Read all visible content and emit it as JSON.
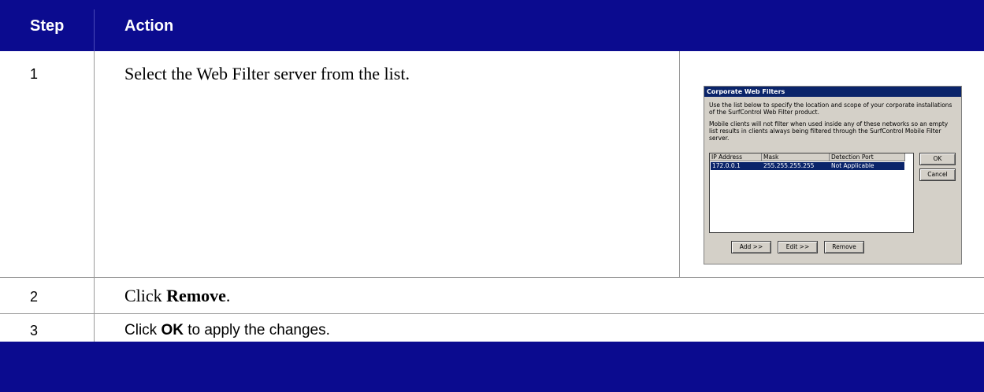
{
  "header": {
    "step_label": "Step",
    "action_label": "Action"
  },
  "rows": [
    {
      "step": "1",
      "text": "Select the Web Filter server from the list."
    },
    {
      "step": "2",
      "text_prefix": "Click ",
      "text_bold": "Remove",
      "text_suffix": "."
    },
    {
      "step": "3",
      "text_prefix": "Click ",
      "text_bold": "OK",
      "text_suffix": " to apply the changes."
    }
  ],
  "dialog": {
    "title": "Corporate Web Filters",
    "para1": "Use the list below to specify the location and scope of your corporate installations of the SurfControl Web Filter product.",
    "para2": "Mobile clients will not filter when used inside any of these networks so an empty list results in clients always being filtered through the SurfControl Mobile Filter server.",
    "columns": [
      "IP Address",
      "Mask",
      "Detection Port"
    ],
    "selected_row": {
      "ip": "172.0.0.1",
      "mask": "255.255.255.255",
      "port": "Not Applicable"
    },
    "buttons": {
      "ok": "OK",
      "cancel": "Cancel",
      "add": "Add >>",
      "edit": "Edit >>",
      "remove": "Remove"
    },
    "colors": {
      "title_bar": "#0a246a",
      "face": "#d4d0c8",
      "selection": "#0a246a"
    }
  },
  "colors": {
    "header_bg": "#0b0b8f",
    "grid_line": "#9a9a9a"
  }
}
